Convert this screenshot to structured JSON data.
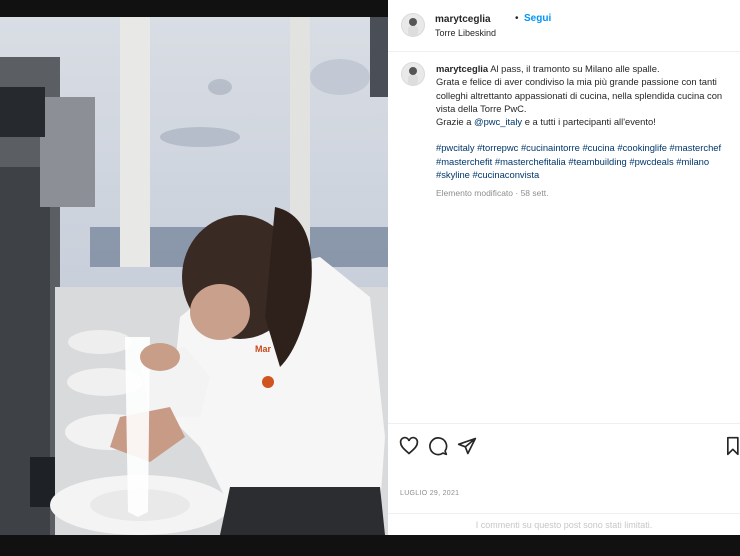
{
  "post": {
    "username": "marytceglia",
    "separator": "•",
    "follow_label": "Segui",
    "location": "Torre Libeskind"
  },
  "caption": {
    "username": "marytceglia",
    "text_1": "Al pass, il tramonto su Milano alle spalle.",
    "text_2": "Grata e felice di aver condiviso la mia più grande passione con tanti colleghi altrettanto appassionati di cucina, nella splendida cucina con vista della Torre PwC.",
    "text_3_pre": "Grazie a ",
    "mention": "@pwc_italy",
    "text_3_post": " e a tutti i partecipanti all'evento!",
    "hashtags": [
      "#pwcitaly",
      "#torrepwc",
      "#cucinaintorre",
      "#cucina",
      "#cookinglife",
      "#masterchef",
      "#masterchefit",
      "#masterchefitalia",
      "#teambuilding",
      "#pwcdeals",
      "#milano",
      "#skyline",
      "#cucinaconvista"
    ],
    "edited": "Elemento modificato · 58 sett."
  },
  "actions": {
    "like_icon": "heart-icon",
    "comment_icon": "comment-icon",
    "share_icon": "share-icon",
    "save_icon": "bookmark-icon"
  },
  "date": "LUGLIO 29, 2021",
  "comments_limited": "I commenti su questo post sono stati limitati."
}
